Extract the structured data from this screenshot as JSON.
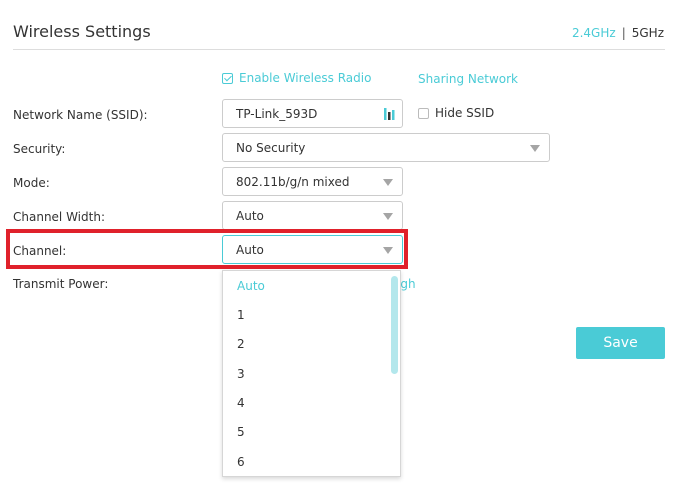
{
  "header": {
    "title": "Wireless Settings",
    "band_24": "2.4GHz",
    "band_sep": "|",
    "band_5": "5GHz"
  },
  "enable_radio": {
    "label": "Enable Wireless Radio",
    "checked": true
  },
  "sharing_link": "Sharing Network",
  "ssid": {
    "label": "Network Name (SSID):",
    "value": "TP-Link_593D",
    "icon": "wifi-bars-icon"
  },
  "hide_ssid": {
    "label": "Hide SSID",
    "checked": false
  },
  "security": {
    "label": "Security:",
    "value": "No Security"
  },
  "mode": {
    "label": "Mode:",
    "value": "802.11b/g/n mixed"
  },
  "channel_width": {
    "label": "Channel Width:",
    "value": "Auto"
  },
  "channel": {
    "label": "Channel:",
    "value": "Auto"
  },
  "transmit_power": {
    "label": "Transmit Power:",
    "visible_value_fragment": "igh"
  },
  "save_label": "Save",
  "channel_options": [
    "Auto",
    "1",
    "2",
    "3",
    "4",
    "5",
    "6"
  ],
  "colors": {
    "accent": "#4acbd6",
    "highlight": "#e0212b"
  }
}
